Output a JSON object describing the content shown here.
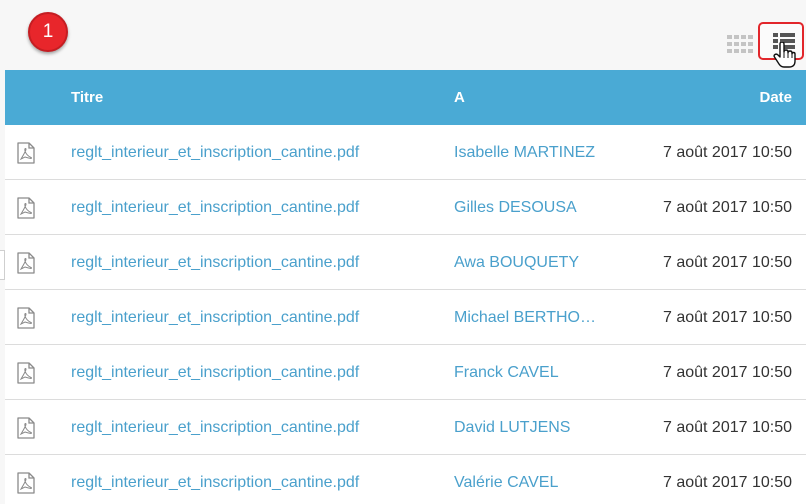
{
  "annotation": {
    "step_number": "1"
  },
  "toolbar": {
    "grid_view_icon": "grid-icon",
    "list_view_icon": "list-icon",
    "highlight_color": "#e2262b"
  },
  "table": {
    "header_color": "#4aaad5",
    "link_color": "#4aa0cc",
    "columns": {
      "title": "Titre",
      "to": "A",
      "date": "Date"
    },
    "rows": [
      {
        "icon": "pdf-icon",
        "title": "reglt_interieur_et_inscription_cantine.pdf",
        "to": "Isabelle MARTINEZ",
        "date": "7 août 2017 10:50"
      },
      {
        "icon": "pdf-icon",
        "title": "reglt_interieur_et_inscription_cantine.pdf",
        "to": "Gilles DESOUSA",
        "date": "7 août 2017 10:50"
      },
      {
        "icon": "pdf-icon",
        "title": "reglt_interieur_et_inscription_cantine.pdf",
        "to": "Awa BOUQUETY",
        "date": "7 août 2017 10:50"
      },
      {
        "icon": "pdf-icon",
        "title": "reglt_interieur_et_inscription_cantine.pdf",
        "to": "Michael BERTHO…",
        "date": "7 août 2017 10:50"
      },
      {
        "icon": "pdf-icon",
        "title": "reglt_interieur_et_inscription_cantine.pdf",
        "to": "Franck CAVEL",
        "date": "7 août 2017 10:50"
      },
      {
        "icon": "pdf-icon",
        "title": "reglt_interieur_et_inscription_cantine.pdf",
        "to": "David LUTJENS",
        "date": "7 août 2017 10:50"
      },
      {
        "icon": "pdf-icon",
        "title": "reglt_interieur_et_inscription_cantine.pdf",
        "to": "Valérie CAVEL",
        "date": "7 août 2017 10:50"
      }
    ]
  }
}
